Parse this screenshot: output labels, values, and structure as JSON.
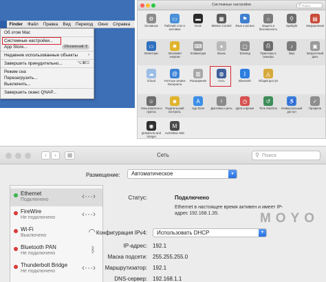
{
  "menubar": {
    "apple_icon": "apple-icon",
    "items": [
      "Finder",
      "Файл",
      "Правка",
      "Вид",
      "Переход",
      "Окно",
      "Справка"
    ]
  },
  "apple_menu": {
    "items": [
      "Об этом Mac",
      "Системные настройки...",
      "App Store...",
      "Недавние использованные объекты",
      "Завершить принудительно...",
      "Режим сна",
      "Перезагрузить...",
      "Выключить...",
      "Завершить сеанс QNAP..."
    ],
    "app_store_badge": "Обновлений: 8",
    "recent_arrow": "›",
    "force_quit_shortcut": "⌥⌘⎋"
  },
  "prefs": {
    "title": "Системные настройки",
    "search_placeholder": "Поиск",
    "rows": [
      [
        {
          "label": "Основные",
          "icon": "general-icon",
          "color": "#8c8c8c",
          "glyph": "⚙"
        },
        {
          "label": "Рабочий стол и заставка",
          "icon": "desktop-icon",
          "color": "#4a90d9",
          "glyph": "▭"
        },
        {
          "label": "Dock",
          "icon": "dock-icon",
          "color": "#2b2b2b",
          "glyph": "▬"
        },
        {
          "label": "Mission Control",
          "icon": "mission-control-icon",
          "color": "#5b5b5b",
          "glyph": "▦"
        },
        {
          "label": "Язык и регион",
          "icon": "language-icon",
          "color": "#3f7fd0",
          "glyph": "⚑"
        },
        {
          "label": "Защита и безопасность",
          "icon": "security-icon",
          "color": "#7c7c7c",
          "glyph": "⌂"
        },
        {
          "label": "Spotlight",
          "icon": "spotlight-icon",
          "color": "#6d6d6d",
          "glyph": "⚲"
        },
        {
          "label": "Уведомления",
          "icon": "notifications-icon",
          "color": "#c94a3a",
          "glyph": "▤"
        }
      ],
      [
        {
          "label": "Мониторы",
          "icon": "displays-icon",
          "color": "#2f6fbf",
          "glyph": "▭"
        },
        {
          "label": "Экономия энергии",
          "icon": "energy-icon",
          "color": "#e0b42c",
          "glyph": "✹"
        },
        {
          "label": "Клавиатура",
          "icon": "keyboard-icon",
          "color": "#9a9a9a",
          "glyph": "⌨"
        },
        {
          "label": "Мышь",
          "icon": "mouse-icon",
          "color": "#b9b9b9",
          "glyph": "●"
        },
        {
          "label": "Трекпад",
          "icon": "trackpad-icon",
          "color": "#8f8f8f",
          "glyph": "▢"
        },
        {
          "label": "Принтеры и сканеры",
          "icon": "printers-icon",
          "color": "#6b6b6b",
          "glyph": "⎙"
        },
        {
          "label": "Звук",
          "icon": "sound-icon",
          "color": "#7a7a7a",
          "glyph": "♪"
        },
        {
          "label": "Загрузочный диск",
          "icon": "startup-disk-icon",
          "color": "#9a9a9a",
          "glyph": "▣"
        }
      ],
      [
        {
          "label": "iCloud",
          "icon": "icloud-icon",
          "color": "#9bbde6",
          "glyph": "☁"
        },
        {
          "label": "Учетные записи Интернета",
          "icon": "internet-accounts-icon",
          "color": "#3d82d6",
          "glyph": "@"
        },
        {
          "label": "Расширения",
          "icon": "extensions-icon",
          "color": "#a8a8a8",
          "glyph": "▥"
        },
        {
          "label": "Сеть",
          "icon": "network-icon",
          "color": "#3f5f9a",
          "glyph": "◍"
        },
        {
          "label": "Bluetooth",
          "icon": "bluetooth-icon",
          "color": "#2c7ee0",
          "glyph": "ᛒ"
        },
        {
          "label": "Общий доступ",
          "icon": "sharing-icon",
          "color": "#d7a93a",
          "glyph": "◬"
        }
      ],
      [
        {
          "label": "Пользователи и группы",
          "icon": "users-icon",
          "color": "#6d6d6d",
          "glyph": "☺"
        },
        {
          "label": "Родительский контроль",
          "icon": "parental-controls-icon",
          "color": "#e0b42c",
          "glyph": "☻"
        },
        {
          "label": "App Store",
          "icon": "app-store-icon",
          "color": "#3b8ee6",
          "glyph": "A"
        },
        {
          "label": "Диктовка и речь",
          "icon": "dictation-icon",
          "color": "#8a8a8a",
          "glyph": "♮"
        },
        {
          "label": "Дата и время",
          "icon": "date-time-icon",
          "color": "#d65050",
          "glyph": "◷"
        },
        {
          "label": "Time Machine",
          "icon": "time-machine-icon",
          "color": "#3e8d5a",
          "glyph": "↺"
        },
        {
          "label": "Универсальный доступ",
          "icon": "accessibility-icon",
          "color": "#3c7fd8",
          "glyph": "♿"
        },
        {
          "label": "Профили",
          "icon": "profiles-icon",
          "color": "#8e8e8e",
          "glyph": "✓"
        }
      ],
      [
        {
          "label": "globalSAN and Xtarget",
          "icon": "globalsan-icon",
          "color": "#2f2f2f",
          "glyph": "◉"
        },
        {
          "label": "Avid Mbox Mini",
          "icon": "avid-mbox-icon",
          "color": "#4a4a4a",
          "glyph": "M"
        }
      ]
    ]
  },
  "network": {
    "title": "Сеть",
    "search_placeholder": "Поиск",
    "location_label": "Размещение:",
    "location_value": "Автоматическое",
    "interfaces": [
      {
        "name": "Ethernet",
        "status": "Подключено",
        "dot": "#38b54a",
        "icon": "ethernet-icon",
        "glyph": "‹···›"
      },
      {
        "name": "FireWire",
        "status": "Не подключено",
        "dot": "#d83b3b",
        "icon": "firewire-icon",
        "glyph": "‹···›"
      },
      {
        "name": "Wi-Fi",
        "status": "Выключено",
        "dot": "#d83b3b",
        "icon": "wifi-icon",
        "glyph": "◠"
      },
      {
        "name": "Bluetooth PAN",
        "status": "Не подключено",
        "dot": "#d83b3b",
        "icon": "bluetooth-icon",
        "glyph": "ᛒ"
      },
      {
        "name": "Thunderbolt Bridge",
        "status": "Не подключено",
        "dot": "#d83b3b",
        "icon": "thunderbolt-bridge-icon",
        "glyph": "‹···›"
      }
    ],
    "status_label": "Статус:",
    "status_value": "Подключено",
    "status_desc": "Ethernet в настоящее время активен и имеет IP-адрес 192.168.1.35.",
    "ipv4_label": "Конфигурация IPv4:",
    "ipv4_value": "Использовать DHCP",
    "ip_label": "IP-адрес:",
    "ip_value": "192.1",
    "mask_label": "Маска подсети:",
    "mask_value": "255.255.255.0",
    "router_label": "Маршрутизатор:",
    "router_value": "192.1",
    "dns_label": "DNS-сервер:",
    "dns_value": "192.168.1.1"
  },
  "watermark": "MOYO"
}
